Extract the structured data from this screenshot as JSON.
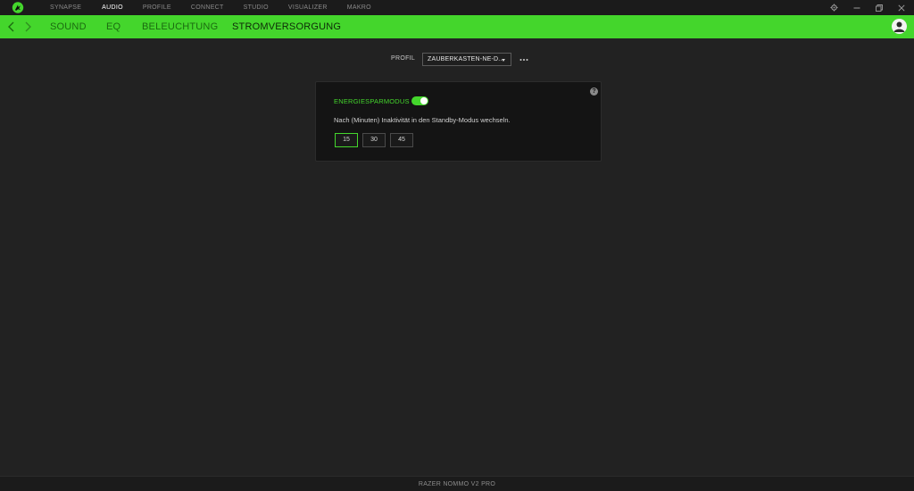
{
  "top_nav": {
    "items": [
      {
        "label": "SYNAPSE"
      },
      {
        "label": "AUDIO"
      },
      {
        "label": "PROFILE"
      },
      {
        "label": "CONNECT"
      },
      {
        "label": "STUDIO"
      },
      {
        "label": "VISUALIZER"
      },
      {
        "label": "MAKRO"
      }
    ],
    "active": "AUDIO"
  },
  "window_controls": [
    "gear-icon",
    "minimize-icon",
    "restore-icon",
    "close-icon"
  ],
  "sub_nav": {
    "tabs": [
      {
        "label": "SOUND"
      },
      {
        "label": "EQ"
      },
      {
        "label": "BELEUCHTUNG"
      },
      {
        "label": "STROMVERSORGUNG"
      }
    ],
    "active": "STROMVERSORGUNG"
  },
  "profile": {
    "label": "PROFIL",
    "selected": "ZAUBERKASTEN-NE-D..."
  },
  "power": {
    "mode_label": "ENERGIESPARMODUS",
    "toggle_on": true,
    "description": "Nach (Minuten) Inaktivität in den Standby-Modus wechseln.",
    "options": [
      "15",
      "30",
      "45"
    ],
    "selected": "15"
  },
  "footer": {
    "device": "RAZER NOMMO V2 PRO"
  },
  "colors": {
    "accent": "#44d62c",
    "background": "#222222",
    "card": "#141414"
  }
}
